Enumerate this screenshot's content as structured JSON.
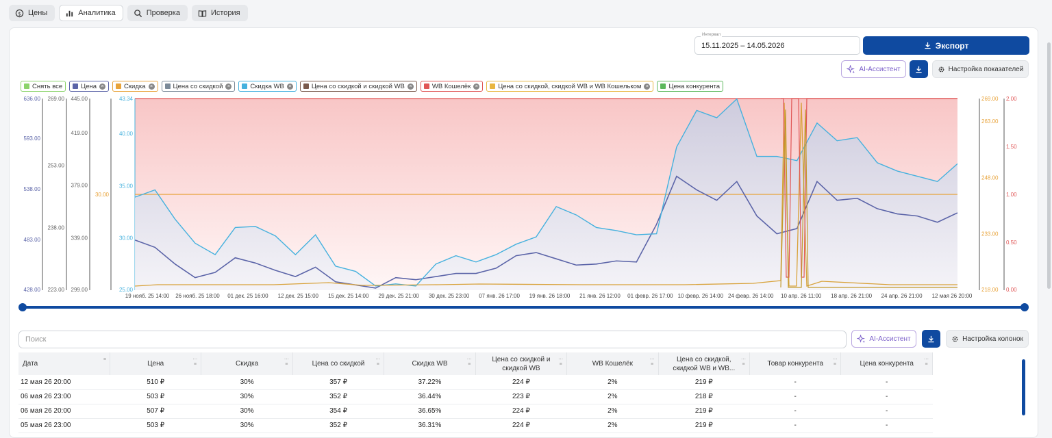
{
  "nav": {
    "tabs": [
      {
        "label": "Цены",
        "icon": "price-icon"
      },
      {
        "label": "Аналитика",
        "icon": "bar-chart-icon",
        "active": true
      },
      {
        "label": "Проверка",
        "icon": "search-icon"
      },
      {
        "label": "История",
        "icon": "book-icon"
      }
    ]
  },
  "interval": {
    "label": "Интервал",
    "value": "15.11.2025 – 14.05.2026"
  },
  "export_label": "Экспорт",
  "ai_label": "AI-Ассистент",
  "settings_metrics_label": "Настройка показателей",
  "settings_columns_label": "Настройка колонок",
  "legend": {
    "deselect_all": "Снять все",
    "items": [
      {
        "label": "Цена",
        "color": "#5b64a8"
      },
      {
        "label": "Скидка",
        "color": "#e8a33a"
      },
      {
        "label": "Цена со скидкой",
        "color": "#7b8a99"
      },
      {
        "label": "Скидка WB",
        "color": "#45b1de"
      },
      {
        "label": "Цена со скидкой и скидкой WB",
        "color": "#7a5a4c"
      },
      {
        "label": "WB Кошелёк",
        "color": "#e05555"
      },
      {
        "label": "Цена со скидкой, скидкой WB и WB Кошельком",
        "color": "#e8b640"
      },
      {
        "label": "Цена конкурента",
        "color": "#5cb85c"
      }
    ]
  },
  "chart_data": {
    "type": "line",
    "x_labels": [
      "19 нояб. 25 14:00",
      "26 нояб. 25 18:00",
      "01 дек. 25 16:00",
      "12 дек. 25 15:00",
      "15 дек. 25 14:00",
      "29 дек. 25 21:00",
      "30 дек. 25 23:00",
      "07 янв. 26 17:00",
      "19 янв. 26 18:00",
      "21 янв. 26 12:00",
      "01 февр. 26 17:00",
      "10 февр. 26 14:00",
      "24 февр. 26 14:00",
      "10 апр. 26 11:00",
      "18 апр. 26 21:00",
      "24 апр. 26 21:00",
      "12 мая 26 20:00"
    ],
    "axes": {
      "price": {
        "ticks": [
          "636.00",
          "593.00",
          "538.00",
          "483.00",
          "428.00"
        ],
        "ylim": [
          428,
          636
        ]
      },
      "axis2": {
        "ticks": [
          "269.00",
          "253.00",
          "238.00",
          "223.00"
        ],
        "ylim": [
          223,
          269
        ]
      },
      "axis3": {
        "ticks": [
          "445.00",
          "419.00",
          "379.00",
          "339.00",
          "299.00"
        ],
        "ylim": [
          299,
          445
        ]
      },
      "discount": {
        "ticks": [
          "30.00"
        ],
        "ylim": [
          0,
          60
        ]
      },
      "wb_discount": {
        "ticks": [
          "43.34",
          "40.00",
          "35.00",
          "30.00",
          "25.00"
        ],
        "ylim": [
          25,
          43.34
        ]
      },
      "right_orange": {
        "ticks": [
          "269.00",
          "263.00",
          "248.00",
          "233.00",
          "218.00"
        ],
        "ylim": [
          218,
          269
        ]
      },
      "right_red": {
        "ticks": [
          "2.00",
          "1.50",
          "1.00",
          "0.50",
          "0.00"
        ],
        "ylim": [
          0,
          2
        ]
      }
    },
    "series": [
      {
        "name": "Скидка WB",
        "color": "#45b1de",
        "axis": "wb_discount",
        "values": [
          33.9,
          34.6,
          31.8,
          29.5,
          28.4,
          31.0,
          31.1,
          30.2,
          28.4,
          30.3,
          27.3,
          26.8,
          25.4,
          25.6,
          25.4,
          27.5,
          28.3,
          27.7,
          28.4,
          29.4,
          30.1,
          33.0,
          32.2,
          31.0,
          30.7,
          30.3,
          30.4,
          38.7,
          42.2,
          41.5,
          43.3,
          37.8,
          37.8,
          37.4,
          41.0,
          39.3,
          39.6,
          37.2,
          36.4,
          35.9,
          35.4,
          37.1
        ]
      },
      {
        "name": "Цена",
        "color": "#5b64a8",
        "axis": "wb_discount",
        "values": [
          29.8,
          29.1,
          27.5,
          26.2,
          26.7,
          28.1,
          27.6,
          26.9,
          26.3,
          27.2,
          25.8,
          25.5,
          25.2,
          26.2,
          26.0,
          26.3,
          26.6,
          26.6,
          27.1,
          28.3,
          28.6,
          28.0,
          27.4,
          27.5,
          27.8,
          27.7,
          31.3,
          35.9,
          34.6,
          33.6,
          35.4,
          32.1,
          30.4,
          30.9,
          35.4,
          33.6,
          33.8,
          32.8,
          32.3,
          32.1,
          31.5,
          32.4
        ]
      }
    ],
    "flat_series": [
      {
        "name": "Скидка",
        "color": "#e8a33a",
        "value": 30
      }
    ]
  },
  "table": {
    "search_placeholder": "Поиск",
    "columns": [
      "Дата",
      "Цена",
      "Скидка",
      "Цена со скидкой",
      "Скидка WB",
      "Цена со скидкой и скидкой WB",
      "WB Кошелёк",
      "Цена со скидкой, скидкой WB и WB...",
      "Товар конкурента",
      "Цена конкурента"
    ],
    "rows": [
      [
        "12 мая 26 20:00",
        "510 ₽",
        "30%",
        "357 ₽",
        "37.22%",
        "224 ₽",
        "2%",
        "219 ₽",
        "-",
        "-"
      ],
      [
        "06 мая 26 23:00",
        "503 ₽",
        "30%",
        "352 ₽",
        "36.44%",
        "223 ₽",
        "2%",
        "218 ₽",
        "-",
        "-"
      ],
      [
        "06 мая 26 20:00",
        "507 ₽",
        "30%",
        "354 ₽",
        "36.65%",
        "224 ₽",
        "2%",
        "219 ₽",
        "-",
        "-"
      ],
      [
        "05 мая 26 23:00",
        "503 ₽",
        "30%",
        "352 ₽",
        "36.31%",
        "224 ₽",
        "2%",
        "219 ₽",
        "-",
        "-"
      ]
    ]
  }
}
